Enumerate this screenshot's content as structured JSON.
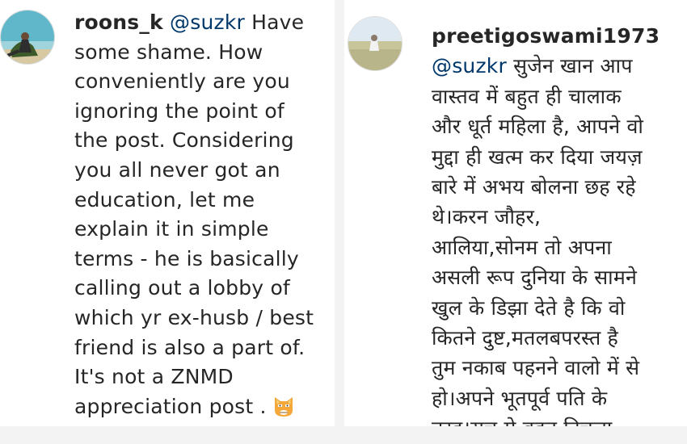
{
  "comments": [
    {
      "username": "roons_k",
      "mention": "@suzkr",
      "text": "Have\nsome shame. How\nconveniently are you\nignoring the point of\nthe post. Considering\nyou all never got an\neducation, let me\nexplain it in simple\nterms - he is basically\ncalling out a lobby of\nwhich yr ex-husb / best\nfriend is also a part of.\nIt's not a ZNMD\nappreciation post .",
      "avatar_icon": "profile-photo-beach",
      "emoji_icon": "cat-face-emoji"
    },
    {
      "username": "preetigoswami1973",
      "mention": "@suzkr",
      "text": "सुजेन खान आप\nवास्तव में बहुत ही चालाक\nऔर धूर्त महिला है, आपने वो\nमुद्दा ही खत्म कर दिया जयज़\nबारे में अभय बोलना छह रहे\nथे।करन जौहर,\nआलिया,सोनम तो अपना\nअसली रूप दुनिया के सामने\nखुल के डिझा देते है कि वो\nकितने दुष्ट,मतलबपरस्त है\nतुम नकाब पहनने वालो में से\nहो।अपने भूतपूर्व पति के\nतरह।सच मे बहत निचला",
      "avatar_icon": "profile-photo-field"
    }
  ],
  "colors": {
    "text": "#262626",
    "mention": "#00376b",
    "divider": "#f3f3f3"
  }
}
